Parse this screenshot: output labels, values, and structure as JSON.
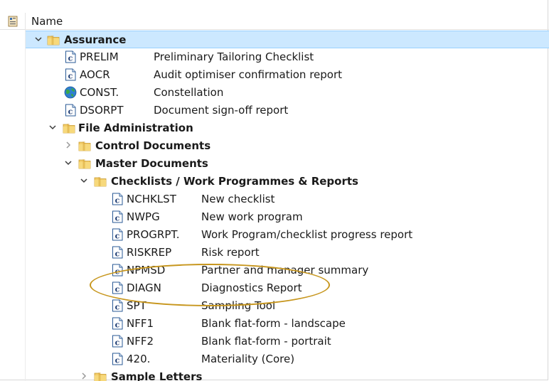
{
  "header": {
    "column_name": "Name"
  },
  "tree": {
    "assurance": {
      "label": "Assurance",
      "items": [
        {
          "code": "PRELIM",
          "desc": "Preliminary Tailoring Checklist",
          "icon": "c-document-icon"
        },
        {
          "code": "AOCR",
          "desc": "Audit optimiser confirmation report",
          "icon": "c-document-icon"
        },
        {
          "code": "CONST.",
          "desc": "Constellation",
          "icon": "globe-icon"
        },
        {
          "code": "DSORPT",
          "desc": "Document sign-off report",
          "icon": "c-document-icon"
        }
      ]
    },
    "file_admin": {
      "label": "File Administration",
      "control_documents": "Control Documents",
      "master_documents": "Master Documents",
      "checklists": {
        "label": "Checklists / Work Programmes & Reports",
        "items": [
          {
            "code": "NCHKLST",
            "desc": "New checklist"
          },
          {
            "code": "NWPG",
            "desc": "New work program"
          },
          {
            "code": "PROGRPT.",
            "desc": "Work Program/checklist progress report"
          },
          {
            "code": "RISKREP",
            "desc": "Risk report"
          },
          {
            "code": "NPMSD",
            "desc": "Partner and manager summary"
          },
          {
            "code": "DIAGN",
            "desc": "Diagnostics Report"
          },
          {
            "code": "SPT",
            "desc": "Sampling Tool"
          },
          {
            "code": "NFF1",
            "desc": "Blank flat-form - landscape"
          },
          {
            "code": "NFF2",
            "desc": "Blank flat-form - portrait"
          },
          {
            "code": "420.",
            "desc": "Materiality (Core)"
          }
        ]
      },
      "sample_letters": "Sample Letters"
    }
  },
  "colors": {
    "selection_bg": "#cce8ff",
    "selection_border": "#99d1ff",
    "folder": "#e8b64a",
    "highlight_ring": "#c7961d",
    "doc_icon_blue": "#2a5a96"
  }
}
